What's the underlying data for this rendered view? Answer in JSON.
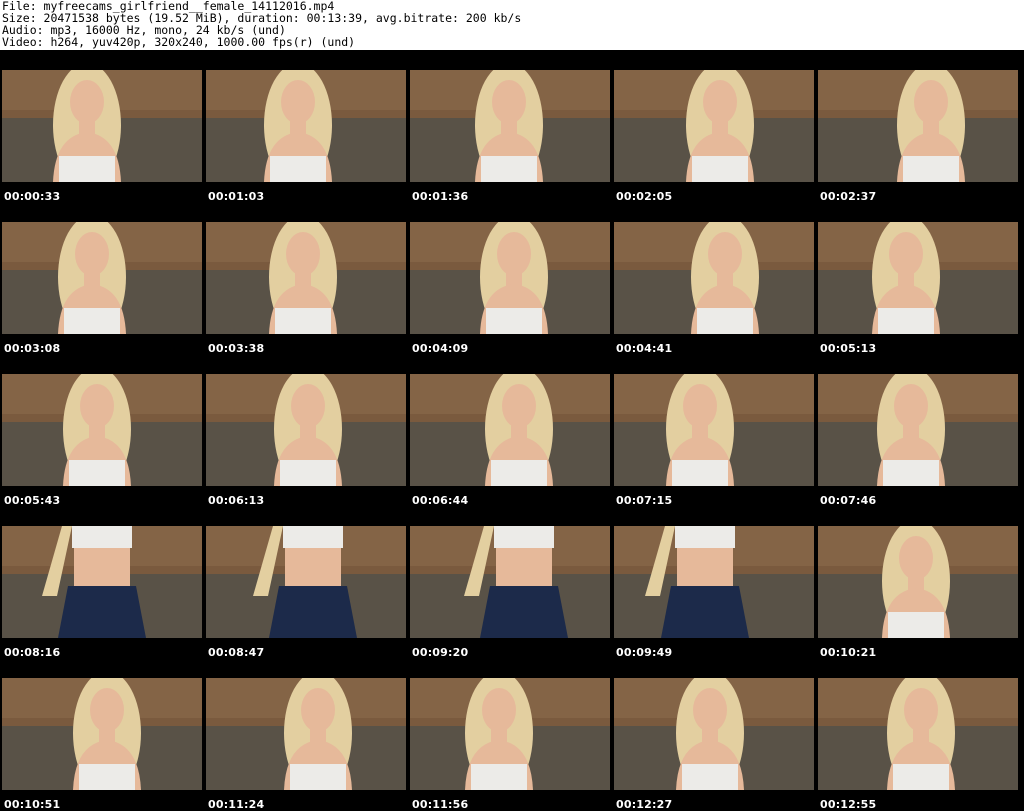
{
  "header": {
    "lines": [
      "File: myfreecams_girlfriend__female_14112016.mp4",
      "Size: 20471538 bytes (19.52 MiB), duration: 00:13:39, avg.bitrate: 200 kb/s",
      "Audio: mp3, 16000 Hz, mono, 24 kb/s (und)",
      "Video: h264, yuv420p, 320x240, 1000.00 fps(r) (und)"
    ]
  },
  "thumbnails": [
    {
      "time": "00:00:33",
      "outfit": "top"
    },
    {
      "time": "00:01:03",
      "outfit": "top"
    },
    {
      "time": "00:01:36",
      "outfit": "top"
    },
    {
      "time": "00:02:05",
      "outfit": "top"
    },
    {
      "time": "00:02:37",
      "outfit": "top"
    },
    {
      "time": "00:03:08",
      "outfit": "top"
    },
    {
      "time": "00:03:38",
      "outfit": "top"
    },
    {
      "time": "00:04:09",
      "outfit": "top"
    },
    {
      "time": "00:04:41",
      "outfit": "top"
    },
    {
      "time": "00:05:13",
      "outfit": "top"
    },
    {
      "time": "00:05:43",
      "outfit": "top"
    },
    {
      "time": "00:06:13",
      "outfit": "top"
    },
    {
      "time": "00:06:44",
      "outfit": "top"
    },
    {
      "time": "00:07:15",
      "outfit": "top"
    },
    {
      "time": "00:07:46",
      "outfit": "top"
    },
    {
      "time": "00:08:16",
      "outfit": "skirt"
    },
    {
      "time": "00:08:47",
      "outfit": "skirt"
    },
    {
      "time": "00:09:20",
      "outfit": "skirt"
    },
    {
      "time": "00:09:49",
      "outfit": "skirt"
    },
    {
      "time": "00:10:21",
      "outfit": "top"
    },
    {
      "time": "00:10:51",
      "outfit": "top"
    },
    {
      "time": "00:11:24",
      "outfit": "top"
    },
    {
      "time": "00:11:56",
      "outfit": "top"
    },
    {
      "time": "00:12:27",
      "outfit": "top"
    },
    {
      "time": "00:12:55",
      "outfit": "top"
    }
  ],
  "colors": {
    "curtain": "#7a5a3e",
    "sofa": "#6b6356",
    "hair": "#e3cfa0",
    "skin": "#e6b99a",
    "top": "#ecebe8",
    "skirt": "#1c2a4a"
  }
}
